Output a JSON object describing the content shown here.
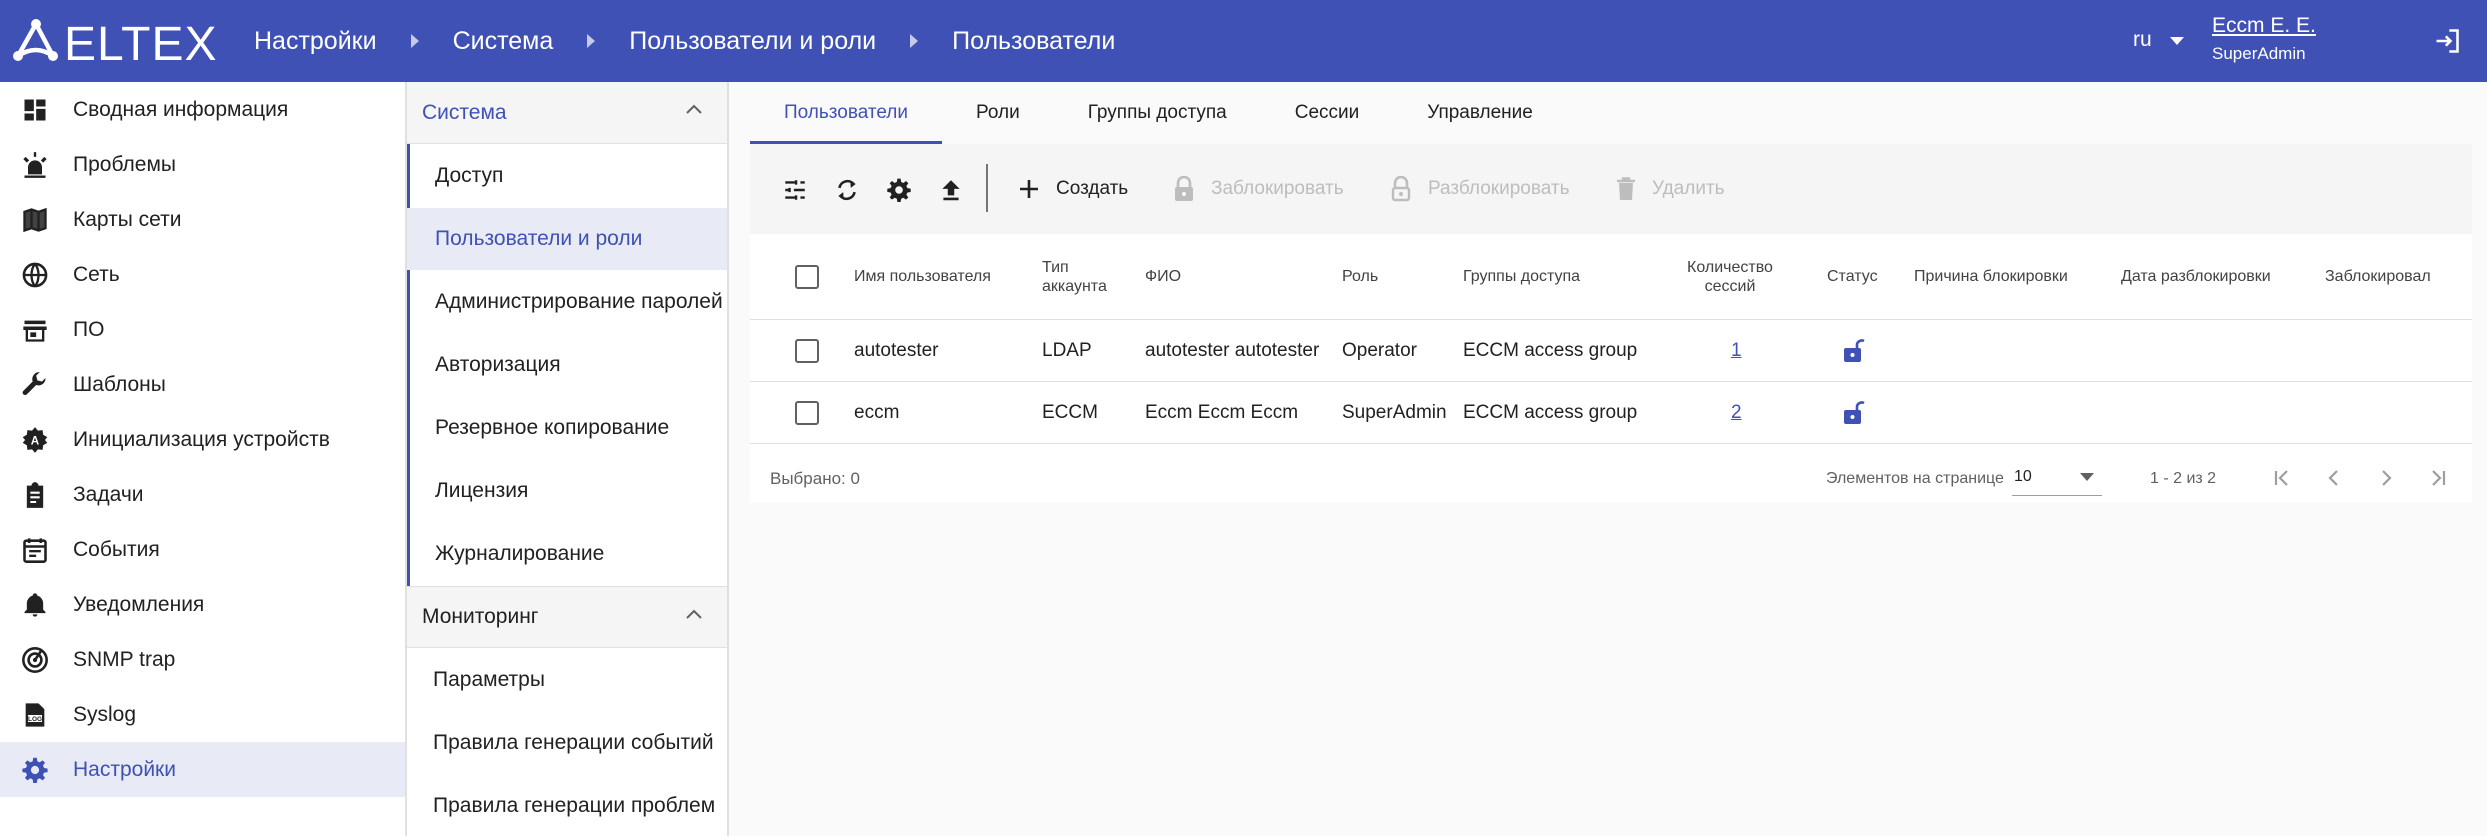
{
  "header": {
    "logo_text": "ELTEX",
    "breadcrumbs": [
      "Настройки",
      "Система",
      "Пользователи и роли",
      "Пользователи"
    ],
    "language": "ru",
    "user_name": "Eccm E. E.",
    "user_role": "SuperAdmin",
    "logout_icon": "logout-icon"
  },
  "sidebar": {
    "items": [
      {
        "label": "Сводная информация",
        "icon": "dashboard-icon"
      },
      {
        "label": "Проблемы",
        "icon": "alarm-light-icon"
      },
      {
        "label": "Карты сети",
        "icon": "map-icon"
      },
      {
        "label": "Сеть",
        "icon": "globe-icon"
      },
      {
        "label": "ПО",
        "icon": "store-icon"
      },
      {
        "label": "Шаблоны",
        "icon": "wrench-icon"
      },
      {
        "label": "Инициализация устройств",
        "icon": "auto-fix-icon"
      },
      {
        "label": "Задачи",
        "icon": "clipboard-icon"
      },
      {
        "label": "События",
        "icon": "calendar-icon"
      },
      {
        "label": "Уведомления",
        "icon": "bell-icon"
      },
      {
        "label": "SNMP trap",
        "icon": "radar-icon"
      },
      {
        "label": "Syslog",
        "icon": "log-icon"
      },
      {
        "label": "Настройки",
        "icon": "gear-icon",
        "active": true
      }
    ]
  },
  "subnav": {
    "groups": [
      {
        "label": "Система",
        "items": [
          "Доступ",
          "Пользователи и роли",
          "Администрирование паролей",
          "Авторизация",
          "Резервное копирование",
          "Лицензия",
          "Журналирование"
        ]
      },
      {
        "label": "Мониторинг",
        "items": [
          "Параметры",
          "Правила генерации событий",
          "Правила генерации проблем"
        ]
      }
    ]
  },
  "tabs": [
    "Пользователи",
    "Роли",
    "Группы доступа",
    "Сессии",
    "Управление"
  ],
  "toolbar": {
    "create": "Создать",
    "block": "Заблокировать",
    "unblock": "Разблокировать",
    "delete": "Удалить",
    "icons": [
      "filter-settings-icon",
      "refresh-icon",
      "gear-icon",
      "upload-icon"
    ]
  },
  "table": {
    "columns": [
      "Имя пользователя",
      "Тип аккаунта",
      "ФИО",
      "Роль",
      "Группы доступа",
      "Количество сессий",
      "Статус",
      "Причина блокировки",
      "Дата разблокировки",
      "Заблокировал"
    ],
    "rows": [
      {
        "username": "autotester",
        "type": "LDAP",
        "fio": "autotester autotester",
        "role": "Operator",
        "groups": "ECCM access group",
        "sessions": "1",
        "status_icon": "lock-open-icon"
      },
      {
        "username": "eccm",
        "type": "ECCM",
        "fio": "Eccm Eccm Eccm",
        "role": "SuperAdmin",
        "groups": "ECCM access group",
        "sessions": "2",
        "status_icon": "lock-open-icon"
      }
    ]
  },
  "footer": {
    "selected": "Выбрано: 0",
    "per_page_label": "Элементов на странице",
    "per_page_value": "10",
    "range": "1 - 2 из 2"
  },
  "colors": {
    "primary": "#3f51b5",
    "active_bg": "#e8eaf6",
    "disabled": "#bdbdbd"
  }
}
